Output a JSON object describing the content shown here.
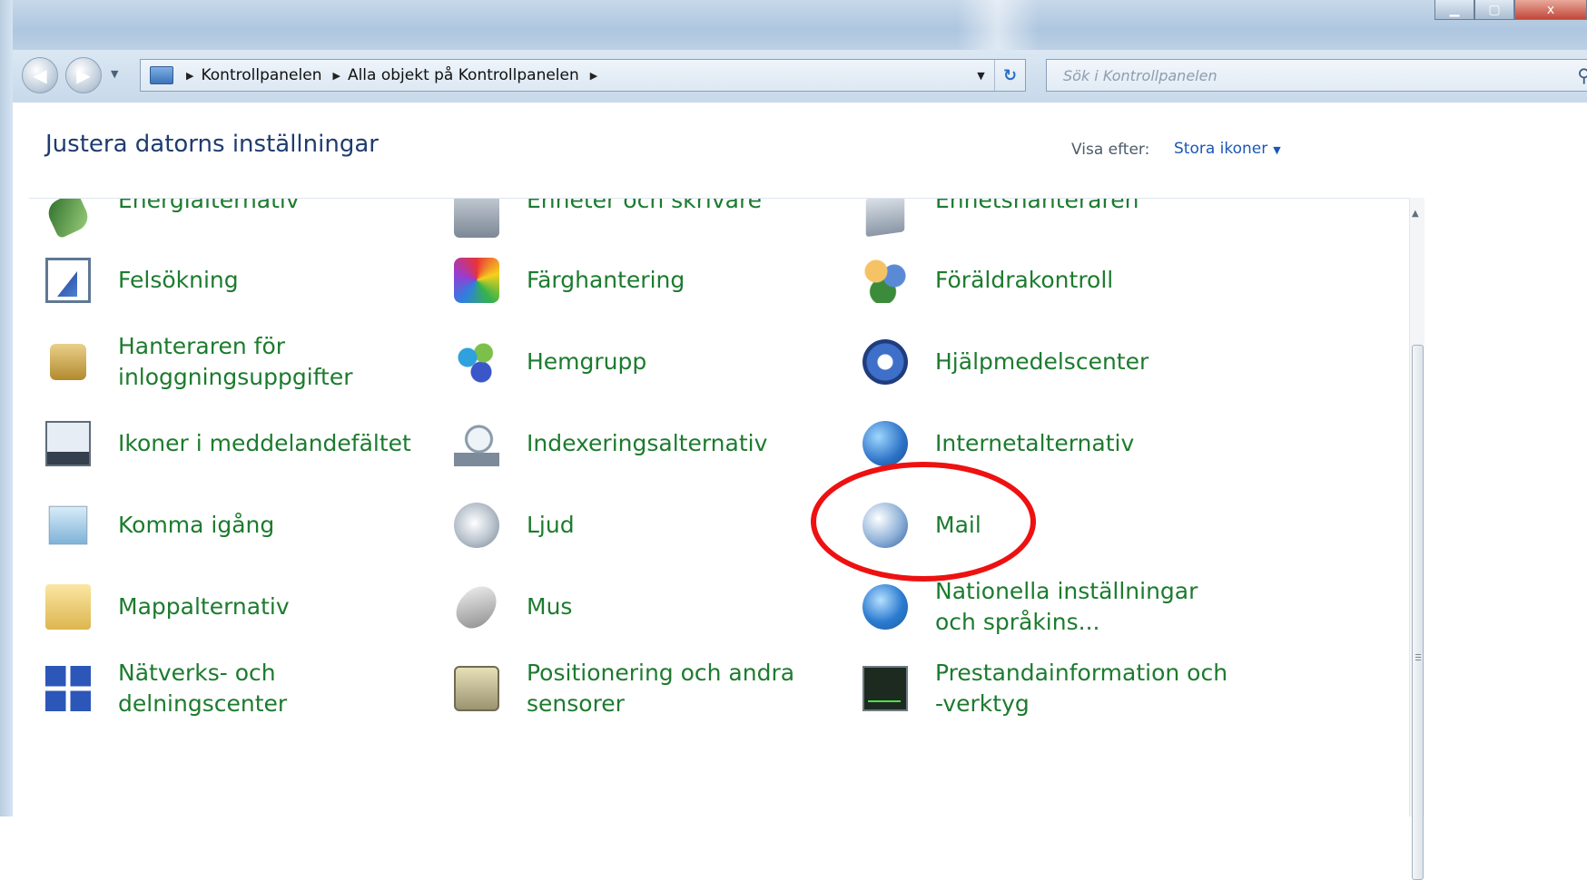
{
  "window": {
    "controls": {
      "minimize_glyph": "▁",
      "maximize_glyph": "▢",
      "close_glyph": "x"
    }
  },
  "navbar": {
    "back_icon": "back-arrow-icon",
    "forward_icon": "forward-arrow-icon",
    "breadcrumb": [
      "Kontrollpanelen",
      "Alla objekt på Kontrollpanelen"
    ],
    "search_placeholder": "Sök i Kontrollpanelen"
  },
  "header": {
    "title": "Justera datorns inställningar",
    "view_by_label": "Visa efter:",
    "view_by_value": "Stora ikoner"
  },
  "items": {
    "col1": [
      {
        "label": "Energialternativ",
        "icon": "power-leaf-icon"
      },
      {
        "label": "Felsökning",
        "icon": "troubleshooting-icon"
      },
      {
        "label": "Hanteraren för\ninloggningsuppgifter",
        "icon": "credential-vault-icon"
      },
      {
        "label": "Ikoner i meddelandefältet",
        "icon": "notification-icons-icon"
      },
      {
        "label": "Komma igång",
        "icon": "getting-started-icon"
      },
      {
        "label": "Mappalternativ",
        "icon": "folder-options-icon"
      },
      {
        "label": "Nätverks- och\ndelningscenter",
        "icon": "network-center-icon"
      }
    ],
    "col2": [
      {
        "label": "Enheter och skrivare",
        "icon": "devices-printers-icon"
      },
      {
        "label": "Färghantering",
        "icon": "color-management-icon"
      },
      {
        "label": "Hemgrupp",
        "icon": "homegroup-icon"
      },
      {
        "label": "Indexeringsalternativ",
        "icon": "indexing-icon"
      },
      {
        "label": "Ljud",
        "icon": "speaker-icon"
      },
      {
        "label": "Mus",
        "icon": "mouse-icon"
      },
      {
        "label": "Positionering och andra\nsensorer",
        "icon": "location-sensor-icon"
      }
    ],
    "col3": [
      {
        "label": "Enhetshanteraren",
        "icon": "device-manager-icon"
      },
      {
        "label": "Föräldrakontroll",
        "icon": "parental-controls-icon"
      },
      {
        "label": "Hjälpmedelscenter",
        "icon": "ease-of-access-icon"
      },
      {
        "label": "Internetalternativ",
        "icon": "internet-options-icon"
      },
      {
        "label": "Mail",
        "icon": "mail-icon"
      },
      {
        "label": "Nationella inställningar\noch språkins...",
        "icon": "region-language-icon"
      },
      {
        "label": "Prestandainformation och\n-verktyg",
        "icon": "performance-tools-icon"
      }
    ]
  },
  "annotation": {
    "highlight_target": "Mail",
    "highlight_color": "#ee1111"
  }
}
